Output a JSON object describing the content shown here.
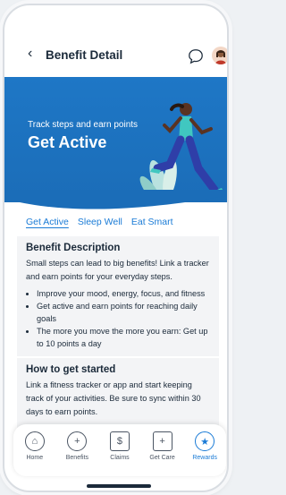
{
  "header": {
    "title": "Benefit Detail",
    "back_icon": "‹"
  },
  "hero": {
    "subtitle": "Track steps and earn points",
    "title": "Get Active",
    "colors": {
      "background": "#1e77c6"
    }
  },
  "tabs": [
    {
      "label": "Get Active",
      "active": true
    },
    {
      "label": "Sleep Well",
      "active": false
    },
    {
      "label": "Eat Smart",
      "active": false
    }
  ],
  "description": {
    "heading": "Benefit Description",
    "text": "Small steps can lead to big benefits! Link a tracker and earn points for your everyday steps.",
    "bullets": [
      "Improve your mood, energy, focus, and fitness",
      "Get active and earn points for reaching daily goals",
      "The more you move the more you earn: Get up to 10 points a day"
    ]
  },
  "get_started": {
    "heading": "How to get started",
    "text": "Link a fitness tracker or app and start keeping track of your activities. Be sure to sync within 30 days to earn points."
  },
  "nav": [
    {
      "label": "Home",
      "icon": "home-icon",
      "glyph": "⌂",
      "active": false
    },
    {
      "label": "Benefits",
      "icon": "benefits-shield-icon",
      "glyph": "+",
      "active": false
    },
    {
      "label": "Claims",
      "icon": "claims-icon",
      "glyph": "$",
      "active": false
    },
    {
      "label": "Get Care",
      "icon": "get-care-icon",
      "glyph": "+",
      "active": false
    },
    {
      "label": "Rewards",
      "icon": "rewards-star-icon",
      "glyph": "★",
      "active": true
    }
  ]
}
